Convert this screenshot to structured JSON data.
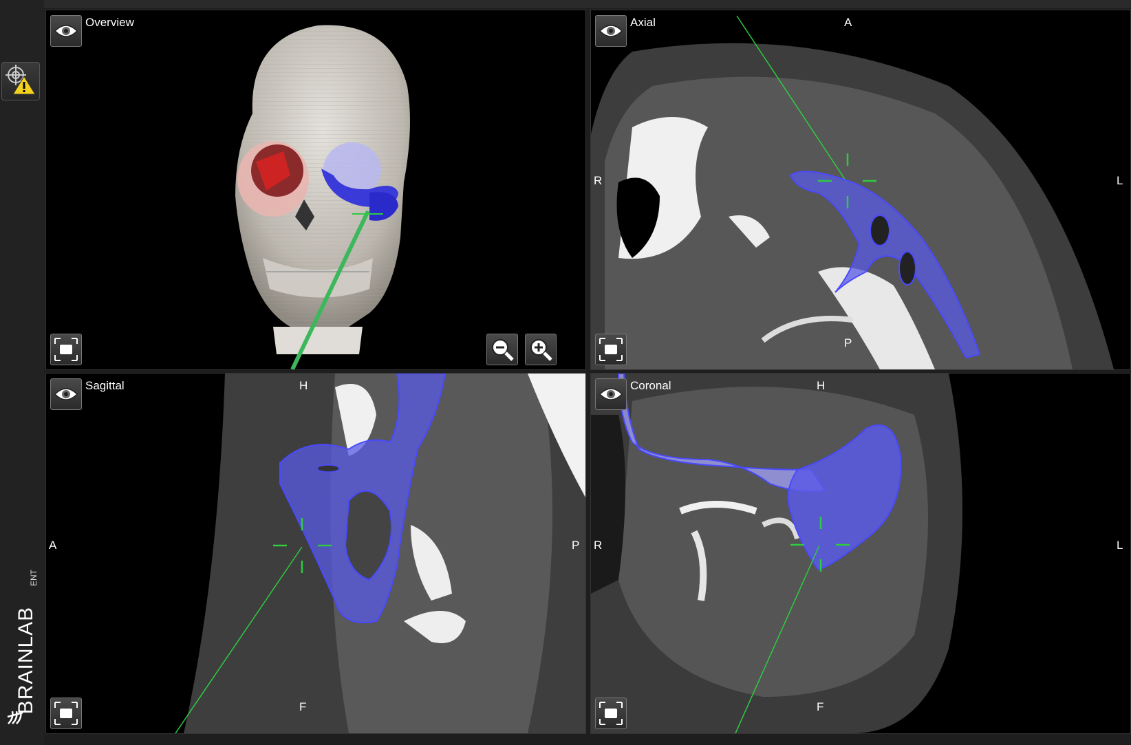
{
  "app": {
    "brand_name": "BRAINLAB",
    "brand_product": "ENT"
  },
  "views": {
    "overview": {
      "title": "Overview"
    },
    "axial": {
      "title": "Axial",
      "top": "A",
      "bottom": "P",
      "left": "R",
      "right": "L"
    },
    "sagittal": {
      "title": "Sagittal",
      "top": "H",
      "bottom": "F",
      "left": "A",
      "right": "P"
    },
    "coronal": {
      "title": "Coronal",
      "top": "H",
      "bottom": "F",
      "left": "R",
      "right": "L"
    }
  },
  "icons": {
    "navigation_warning": "target-warning-icon",
    "eye": "eye-icon",
    "fullscreen": "fullscreen-icon",
    "zoom_out": "zoom-out-icon",
    "zoom_in": "zoom-in-icon"
  },
  "colors": {
    "segmentation": "#5a5ae6",
    "segmentation_light": "#9c9cf0",
    "crosshair": "#2ecc40",
    "warning": "#f2d21b"
  }
}
